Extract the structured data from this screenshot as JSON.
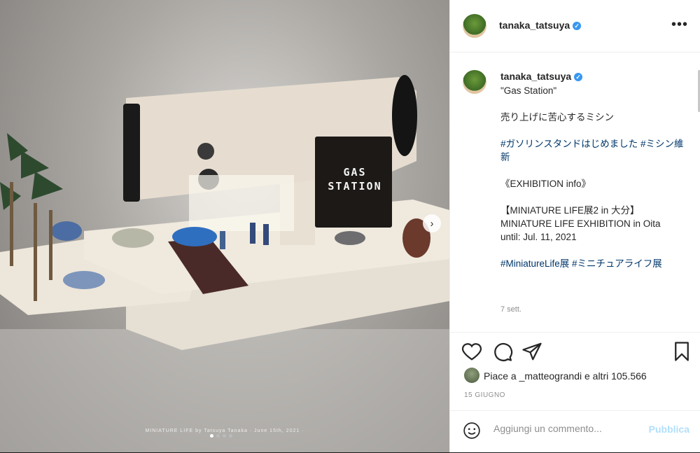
{
  "post": {
    "username": "tanaka_tatsuya",
    "more_label": "•••",
    "watermark": "MINIATURE LIFE by Tatsuya Tanaka · June 15th, 2021 ·",
    "sign_text_line1": "GAS",
    "sign_text_line2": "STATION"
  },
  "caption": {
    "username": "tanaka_tatsuya",
    "title": "\"Gas Station\"",
    "line_jp": "売り上げに苦心するミシン",
    "hashtags_line": "#ガソリンスタンドはじめました #ミシン維新",
    "divider": "________________________________",
    "exhibition_header": "《EXHIBITION info》",
    "exhibition_title": "【MINIATURE LIFE展2 in 大分】",
    "exhibition_en": "MINIATURE LIFE EXHIBITION in Oita",
    "until": "until: Jul. 11, 2021",
    "hashtags_2": "#MiniatureLife展 #ミニチュアライフ展",
    "time_ago": "7 sett."
  },
  "actions": {
    "likes_text": "Piace a _matteograndi e altri 105.566",
    "date": "15 GIUGNO"
  },
  "comment": {
    "placeholder": "Aggiungi un commento...",
    "post_label": "Pubblica"
  },
  "icons": [
    "heart-icon",
    "comment-icon",
    "share-icon",
    "bookmark-icon",
    "emoji-icon",
    "next-arrow-icon"
  ]
}
